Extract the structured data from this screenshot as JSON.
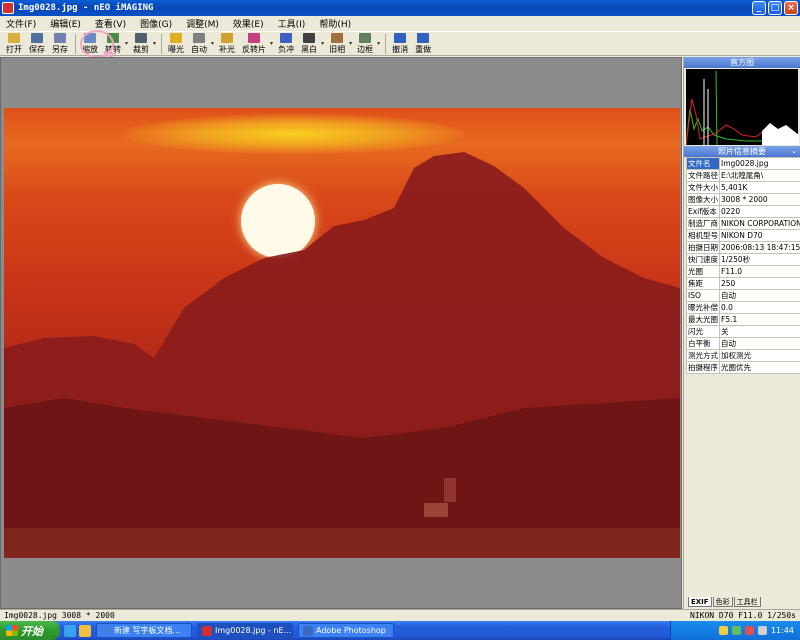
{
  "window": {
    "title": "Img0028.jpg - nEO iMAGING",
    "buttons": [
      "_",
      "□",
      "×"
    ]
  },
  "menu": [
    "文件(F)",
    "编辑(E)",
    "查看(V)",
    "图像(G)",
    "调整(M)",
    "效果(E)",
    "工具(I)",
    "帮助(H)"
  ],
  "toolbar": [
    {
      "label": "打开",
      "icon": "folder-open-icon",
      "color": "#d8b040"
    },
    {
      "label": "保存",
      "icon": "save-disk-icon",
      "color": "#5070a0"
    },
    {
      "label": "另存",
      "icon": "save-as-icon",
      "color": "#7080b0"
    },
    {
      "label": "缩放",
      "icon": "zoom-icon",
      "color": "#6a8ac8"
    },
    {
      "label": "转转",
      "icon": "rotate-icon",
      "color": "#4a8a4a",
      "dropdown": true
    },
    {
      "label": "裁剪",
      "icon": "crop-icon",
      "color": "#506070",
      "dropdown": true
    },
    {
      "label": "曝光",
      "icon": "exposure-icon",
      "color": "#e0b020"
    },
    {
      "label": "自动",
      "icon": "auto-adjust-icon",
      "color": "#808080",
      "dropdown": true
    },
    {
      "label": "补光",
      "icon": "fill-light-icon",
      "color": "#d0a030"
    },
    {
      "label": "反转片",
      "icon": "slide-film-icon",
      "color": "#c04080",
      "dropdown": true
    },
    {
      "label": "负冲",
      "icon": "cross-process-icon",
      "color": "#4060c0"
    },
    {
      "label": "黑白",
      "icon": "black-white-icon",
      "color": "#404040",
      "dropdown": true
    },
    {
      "label": "旧相",
      "icon": "old-photo-icon",
      "color": "#a07040",
      "dropdown": true
    },
    {
      "label": "边框",
      "icon": "frame-border-icon",
      "color": "#608060",
      "dropdown": true
    },
    {
      "label": "撤消",
      "icon": "undo-icon",
      "color": "#3060c0"
    },
    {
      "label": "重做",
      "icon": "redo-icon",
      "color": "#3060c0"
    }
  ],
  "histogram": {
    "title": "直方图"
  },
  "photo_info": {
    "title": "照片信息摘要",
    "rows": [
      {
        "key": "文件名",
        "value": "Img0028.jpg"
      },
      {
        "key": "文件路径",
        "value": "E:\\北隍尾角\\"
      },
      {
        "key": "文件大小",
        "value": "5,401K"
      },
      {
        "key": "图像大小",
        "value": "3008 * 2000"
      },
      {
        "key": "Exif版本",
        "value": "0220"
      },
      {
        "key": "制造厂商",
        "value": "NIKON CORPORATION"
      },
      {
        "key": "相机型号",
        "value": "NIKON D70"
      },
      {
        "key": "拍摄日期",
        "value": "2006:08:13 18:47:15"
      },
      {
        "key": "快门速度",
        "value": "1/250秒"
      },
      {
        "key": "光圈",
        "value": "F11.0"
      },
      {
        "key": "焦距",
        "value": "250"
      },
      {
        "key": "ISO",
        "value": "自动"
      },
      {
        "key": "曝光补偿",
        "value": "0.0"
      },
      {
        "key": "最大光圈",
        "value": "F5.1"
      },
      {
        "key": "闪光",
        "value": "关"
      },
      {
        "key": "白平衡",
        "value": "自动"
      },
      {
        "key": "测光方式",
        "value": "加权测光"
      },
      {
        "key": "拍摄程序",
        "value": "光圈优先"
      }
    ],
    "tabs": [
      "EXIF",
      "色彩",
      "工具栏"
    ]
  },
  "status": {
    "left": "Img0028.jpg 3008 * 2000",
    "right": "NIKON D70 F11.0 1/250s"
  },
  "taskbar": {
    "start": "开始",
    "tasks": [
      {
        "label": "新建 写字板文档...",
        "color": "#4080e0"
      },
      {
        "label": "Img0028.jpg - nE...",
        "color": "#d03030",
        "active": true
      },
      {
        "label": "Adobe Photoshop",
        "color": "#3a6ac0"
      }
    ],
    "clock": "11:44"
  }
}
